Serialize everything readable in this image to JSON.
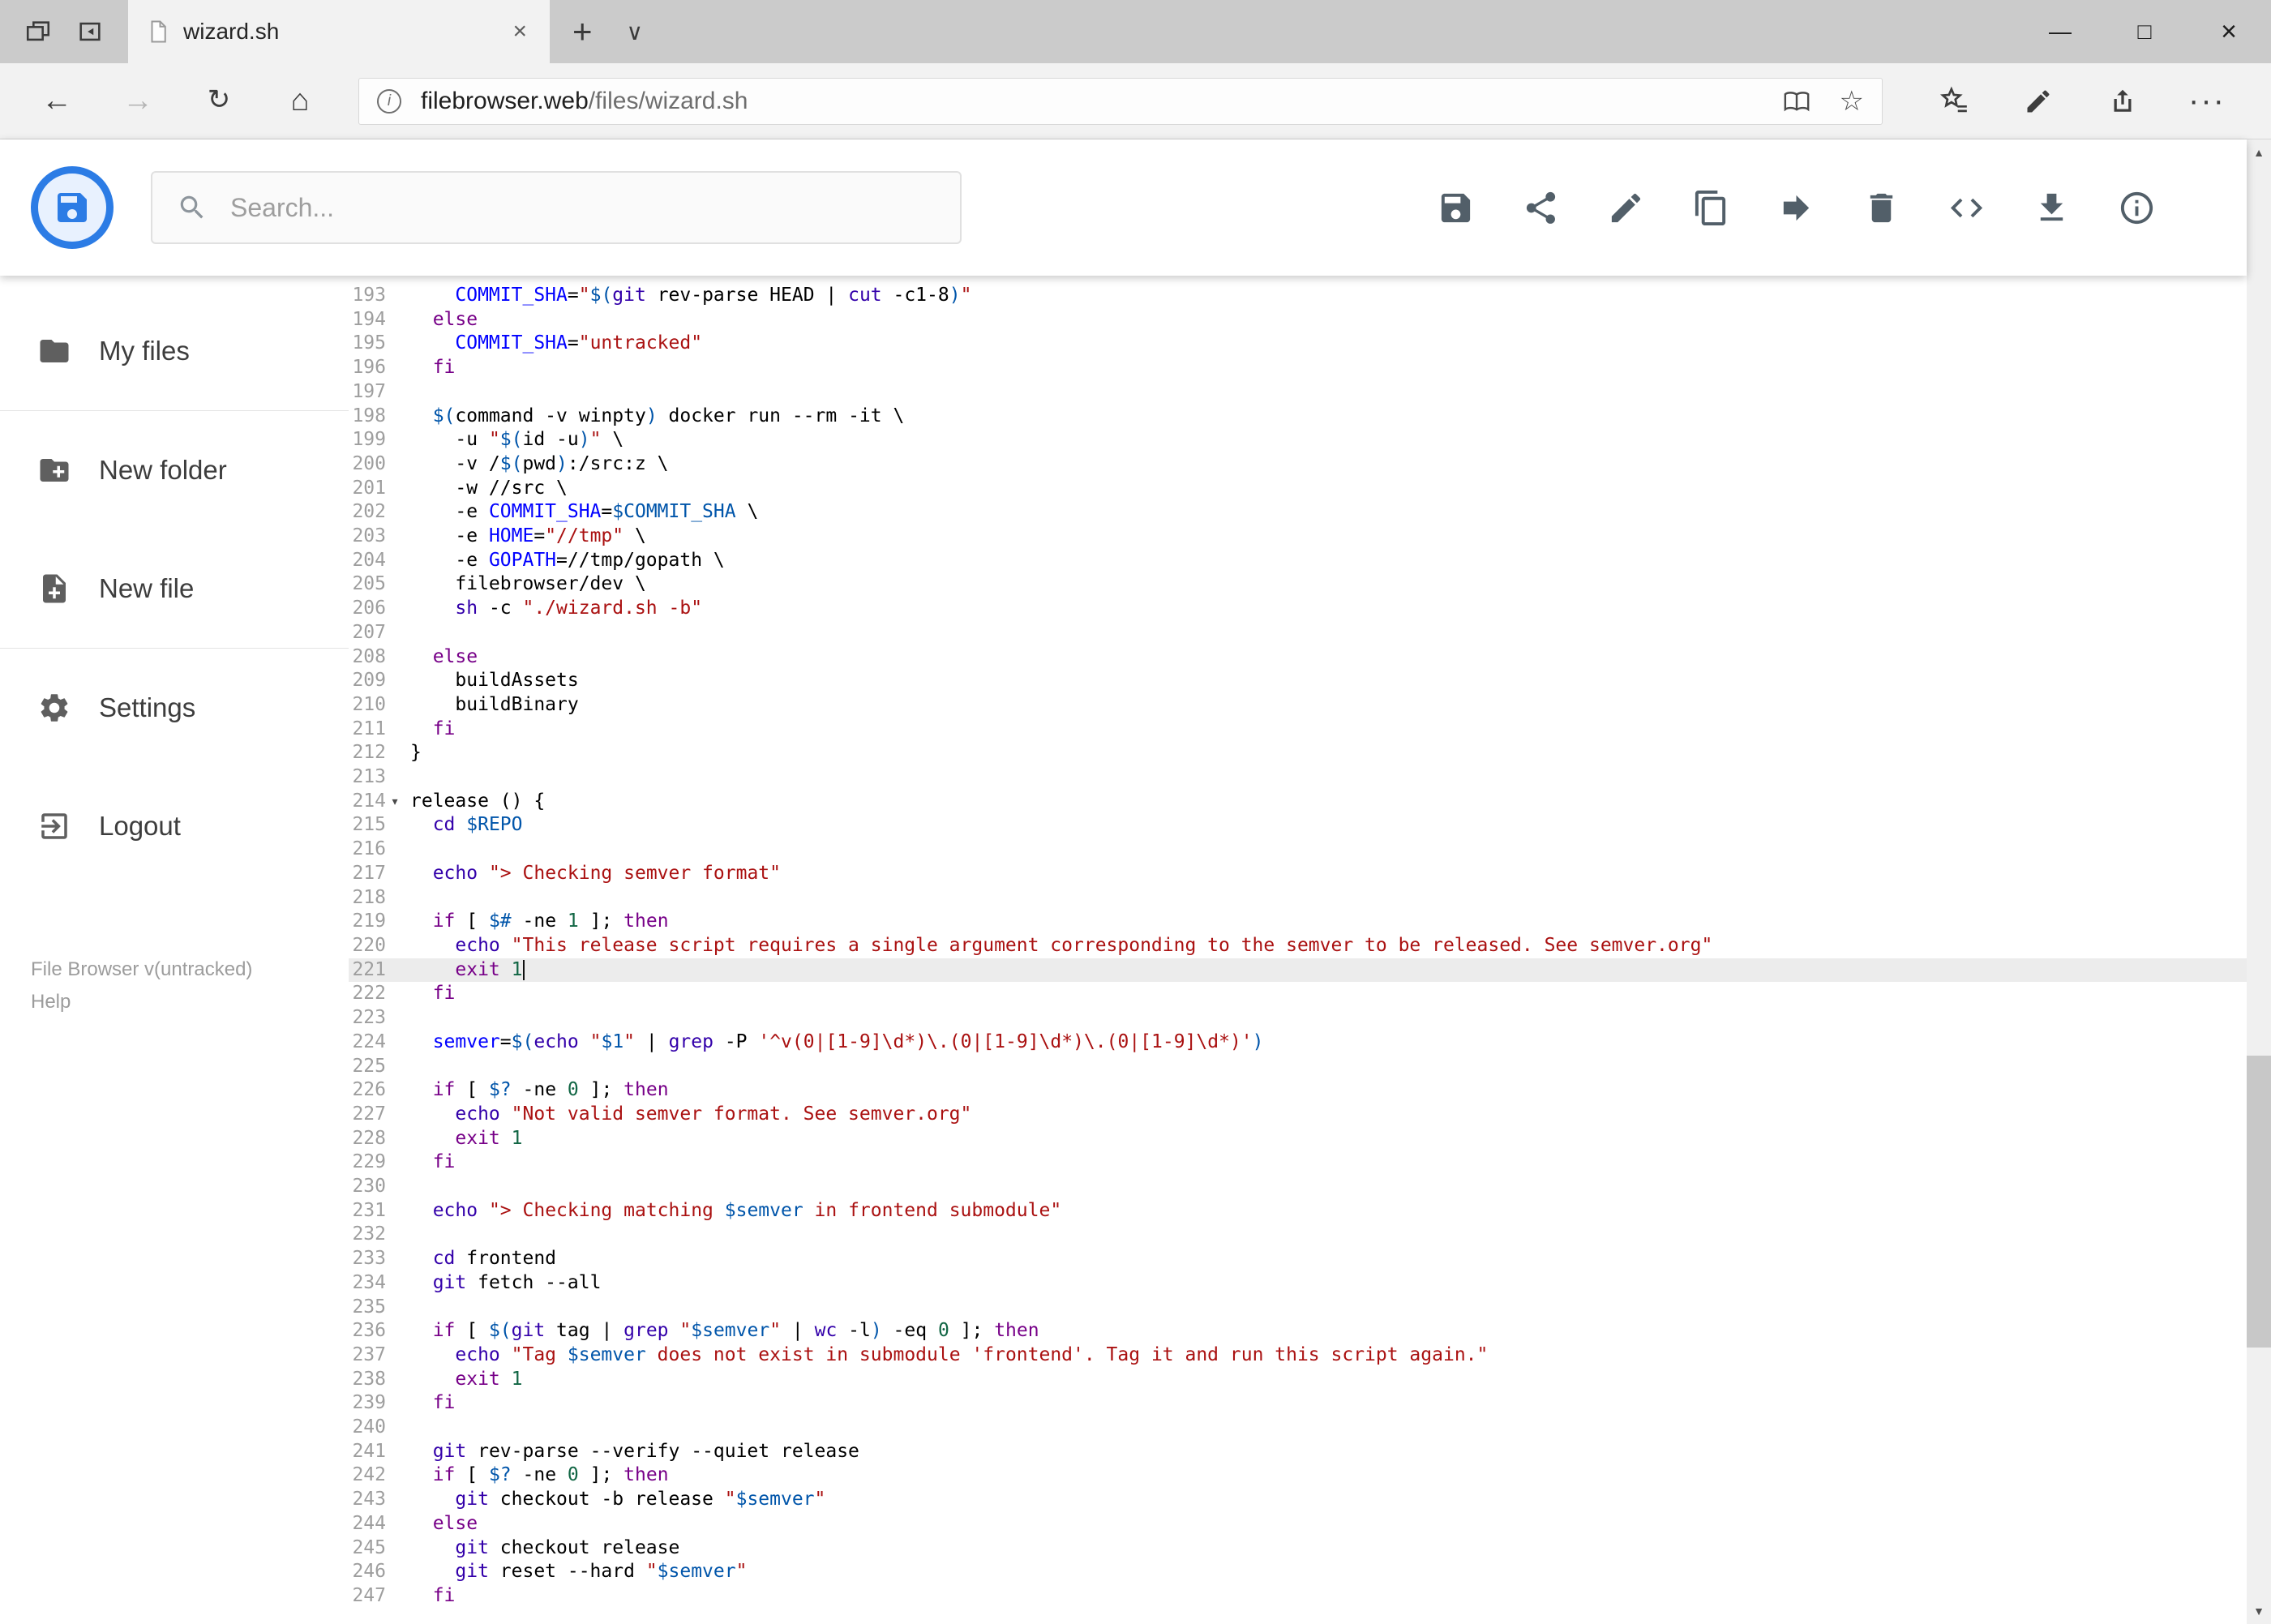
{
  "browser": {
    "tab_title": "wizard.sh",
    "url_host": "filebrowser.web",
    "url_path": "/files/wizard.sh"
  },
  "icons": {
    "back": "←",
    "forward": "→",
    "refresh": "↻",
    "home": "⌂",
    "new_tab": "+",
    "tab_preview": "∨",
    "minimize": "—",
    "maximize": "□",
    "close_window": "×",
    "close_tab": "×",
    "info_badge": "i",
    "favorite_star": "☆",
    "more": "···",
    "code_button_glyph": "<>",
    "scroll_up": "▲",
    "scroll_down": "▼",
    "fold_marker": "▾"
  },
  "header": {
    "search_placeholder": "Search...",
    "actions": [
      "save",
      "share",
      "rename",
      "copy",
      "move",
      "delete",
      "code",
      "download",
      "info"
    ]
  },
  "sidebar": {
    "items": [
      {
        "label": "My files"
      },
      {
        "label": "New folder"
      },
      {
        "label": "New file"
      },
      {
        "label": "Settings"
      },
      {
        "label": "Logout"
      }
    ],
    "footer_version": "File Browser v(untracked)",
    "footer_help": "Help"
  },
  "colors": {
    "accent_blue": "#2c7ce5",
    "keyword": "#770088",
    "builtin": "#3300aa",
    "string": "#aa1111",
    "variable": "#0055aa",
    "definition": "#0000ff",
    "number": "#116644",
    "active_line_bg": "#ececec"
  },
  "editor": {
    "active_line": 221,
    "cursor_line": 221,
    "lines": [
      {
        "n": 193,
        "t": [
          [
            "p",
            "    "
          ],
          [
            "d",
            "COMMIT_SHA"
          ],
          [
            "p",
            "="
          ],
          [
            "s",
            "\""
          ],
          [
            "v",
            "$("
          ],
          [
            "b",
            "git"
          ],
          [
            "p",
            " rev-parse HEAD | "
          ],
          [
            "b",
            "cut"
          ],
          [
            "p",
            " -c1-8"
          ],
          [
            "v",
            ")"
          ],
          [
            "s",
            "\""
          ]
        ]
      },
      {
        "n": 194,
        "t": [
          [
            "p",
            "  "
          ],
          [
            "k",
            "else"
          ]
        ]
      },
      {
        "n": 195,
        "t": [
          [
            "p",
            "    "
          ],
          [
            "d",
            "COMMIT_SHA"
          ],
          [
            "p",
            "="
          ],
          [
            "s",
            "\"untracked\""
          ]
        ]
      },
      {
        "n": 196,
        "t": [
          [
            "p",
            "  "
          ],
          [
            "k",
            "fi"
          ]
        ]
      },
      {
        "n": 197,
        "t": []
      },
      {
        "n": 198,
        "t": [
          [
            "p",
            "  "
          ],
          [
            "v",
            "$("
          ],
          [
            "p",
            "command -v winpty"
          ],
          [
            "v",
            ")"
          ],
          [
            "p",
            " docker run --rm -it \\"
          ]
        ]
      },
      {
        "n": 199,
        "t": [
          [
            "p",
            "    -u "
          ],
          [
            "s",
            "\""
          ],
          [
            "v",
            "$("
          ],
          [
            "p",
            "id -u"
          ],
          [
            "v",
            ")"
          ],
          [
            "s",
            "\""
          ],
          [
            "p",
            " \\"
          ]
        ]
      },
      {
        "n": 200,
        "t": [
          [
            "p",
            "    -v /"
          ],
          [
            "v",
            "$("
          ],
          [
            "p",
            "pwd"
          ],
          [
            "v",
            ")"
          ],
          [
            "p",
            ":/src:z \\"
          ]
        ]
      },
      {
        "n": 201,
        "t": [
          [
            "p",
            "    -w //src \\"
          ]
        ]
      },
      {
        "n": 202,
        "t": [
          [
            "p",
            "    -e "
          ],
          [
            "d",
            "COMMIT_SHA"
          ],
          [
            "p",
            "="
          ],
          [
            "v",
            "$COMMIT_SHA"
          ],
          [
            "p",
            " \\"
          ]
        ]
      },
      {
        "n": 203,
        "t": [
          [
            "p",
            "    -e "
          ],
          [
            "d",
            "HOME"
          ],
          [
            "p",
            "="
          ],
          [
            "s",
            "\"//tmp\""
          ],
          [
            "p",
            " \\"
          ]
        ]
      },
      {
        "n": 204,
        "t": [
          [
            "p",
            "    -e "
          ],
          [
            "d",
            "GOPATH"
          ],
          [
            "p",
            "=//tmp/gopath \\"
          ]
        ]
      },
      {
        "n": 205,
        "t": [
          [
            "p",
            "    filebrowser/dev \\"
          ]
        ]
      },
      {
        "n": 206,
        "t": [
          [
            "p",
            "    "
          ],
          [
            "b",
            "sh"
          ],
          [
            "p",
            " -c "
          ],
          [
            "s",
            "\"./wizard.sh -b\""
          ]
        ]
      },
      {
        "n": 207,
        "t": []
      },
      {
        "n": 208,
        "t": [
          [
            "p",
            "  "
          ],
          [
            "k",
            "else"
          ]
        ]
      },
      {
        "n": 209,
        "t": [
          [
            "p",
            "    buildAssets"
          ]
        ]
      },
      {
        "n": 210,
        "t": [
          [
            "p",
            "    buildBinary"
          ]
        ]
      },
      {
        "n": 211,
        "t": [
          [
            "p",
            "  "
          ],
          [
            "k",
            "fi"
          ]
        ]
      },
      {
        "n": 212,
        "t": [
          [
            "p",
            "}"
          ]
        ]
      },
      {
        "n": 213,
        "t": []
      },
      {
        "n": 214,
        "fold": true,
        "t": [
          [
            "p",
            "release () {"
          ]
        ]
      },
      {
        "n": 215,
        "t": [
          [
            "p",
            "  "
          ],
          [
            "b",
            "cd"
          ],
          [
            "p",
            " "
          ],
          [
            "v",
            "$REPO"
          ]
        ]
      },
      {
        "n": 216,
        "t": []
      },
      {
        "n": 217,
        "t": [
          [
            "p",
            "  "
          ],
          [
            "b",
            "echo"
          ],
          [
            "p",
            " "
          ],
          [
            "s",
            "\"> Checking semver format\""
          ]
        ]
      },
      {
        "n": 218,
        "t": []
      },
      {
        "n": 219,
        "t": [
          [
            "p",
            "  "
          ],
          [
            "k",
            "if"
          ],
          [
            "p",
            " [ "
          ],
          [
            "v",
            "$#"
          ],
          [
            "p",
            " -ne "
          ],
          [
            "num",
            "1"
          ],
          [
            "p",
            " ]; "
          ],
          [
            "k",
            "then"
          ]
        ]
      },
      {
        "n": 220,
        "t": [
          [
            "p",
            "    "
          ],
          [
            "b",
            "echo"
          ],
          [
            "p",
            " "
          ],
          [
            "s",
            "\"This release script requires a single argument corresponding to the semver to be released. See semver.org\""
          ]
        ]
      },
      {
        "n": 221,
        "t": [
          [
            "p",
            "    "
          ],
          [
            "k",
            "exit"
          ],
          [
            "p",
            " "
          ],
          [
            "num",
            "1"
          ]
        ]
      },
      {
        "n": 222,
        "t": [
          [
            "p",
            "  "
          ],
          [
            "k",
            "fi"
          ]
        ]
      },
      {
        "n": 223,
        "t": []
      },
      {
        "n": 224,
        "t": [
          [
            "p",
            "  "
          ],
          [
            "d",
            "semver"
          ],
          [
            "p",
            "="
          ],
          [
            "v",
            "$("
          ],
          [
            "b",
            "echo"
          ],
          [
            "p",
            " "
          ],
          [
            "s",
            "\""
          ],
          [
            "v",
            "$1"
          ],
          [
            "s",
            "\""
          ],
          [
            "p",
            " | "
          ],
          [
            "b",
            "grep"
          ],
          [
            "p",
            " -P "
          ],
          [
            "s",
            "'^v(0|[1-9]\\d*)\\.(0|[1-9]\\d*)\\.(0|[1-9]\\d*)'"
          ],
          [
            "v",
            ")"
          ]
        ]
      },
      {
        "n": 225,
        "t": []
      },
      {
        "n": 226,
        "t": [
          [
            "p",
            "  "
          ],
          [
            "k",
            "if"
          ],
          [
            "p",
            " [ "
          ],
          [
            "v",
            "$?"
          ],
          [
            "p",
            " -ne "
          ],
          [
            "num",
            "0"
          ],
          [
            "p",
            " ]; "
          ],
          [
            "k",
            "then"
          ]
        ]
      },
      {
        "n": 227,
        "t": [
          [
            "p",
            "    "
          ],
          [
            "b",
            "echo"
          ],
          [
            "p",
            " "
          ],
          [
            "s",
            "\"Not valid semver format. See semver.org\""
          ]
        ]
      },
      {
        "n": 228,
        "t": [
          [
            "p",
            "    "
          ],
          [
            "k",
            "exit"
          ],
          [
            "p",
            " "
          ],
          [
            "num",
            "1"
          ]
        ]
      },
      {
        "n": 229,
        "t": [
          [
            "p",
            "  "
          ],
          [
            "k",
            "fi"
          ]
        ]
      },
      {
        "n": 230,
        "t": []
      },
      {
        "n": 231,
        "t": [
          [
            "p",
            "  "
          ],
          [
            "b",
            "echo"
          ],
          [
            "p",
            " "
          ],
          [
            "s",
            "\"> Checking matching "
          ],
          [
            "v",
            "$semver"
          ],
          [
            "s",
            " in frontend submodule\""
          ]
        ]
      },
      {
        "n": 232,
        "t": []
      },
      {
        "n": 233,
        "t": [
          [
            "p",
            "  "
          ],
          [
            "b",
            "cd"
          ],
          [
            "p",
            " frontend"
          ]
        ]
      },
      {
        "n": 234,
        "t": [
          [
            "p",
            "  "
          ],
          [
            "b",
            "git"
          ],
          [
            "p",
            " fetch --all"
          ]
        ]
      },
      {
        "n": 235,
        "t": []
      },
      {
        "n": 236,
        "t": [
          [
            "p",
            "  "
          ],
          [
            "k",
            "if"
          ],
          [
            "p",
            " [ "
          ],
          [
            "v",
            "$("
          ],
          [
            "b",
            "git"
          ],
          [
            "p",
            " tag | "
          ],
          [
            "b",
            "grep"
          ],
          [
            "p",
            " "
          ],
          [
            "s",
            "\""
          ],
          [
            "v",
            "$semver"
          ],
          [
            "s",
            "\""
          ],
          [
            "p",
            " | "
          ],
          [
            "b",
            "wc"
          ],
          [
            "p",
            " -l"
          ],
          [
            "v",
            ")"
          ],
          [
            "p",
            " -eq "
          ],
          [
            "num",
            "0"
          ],
          [
            "p",
            " ]; "
          ],
          [
            "k",
            "then"
          ]
        ]
      },
      {
        "n": 237,
        "t": [
          [
            "p",
            "    "
          ],
          [
            "b",
            "echo"
          ],
          [
            "p",
            " "
          ],
          [
            "s",
            "\"Tag "
          ],
          [
            "v",
            "$semver"
          ],
          [
            "s",
            " does not exist in submodule 'frontend'. Tag it and run this script again.\""
          ]
        ]
      },
      {
        "n": 238,
        "t": [
          [
            "p",
            "    "
          ],
          [
            "k",
            "exit"
          ],
          [
            "p",
            " "
          ],
          [
            "num",
            "1"
          ]
        ]
      },
      {
        "n": 239,
        "t": [
          [
            "p",
            "  "
          ],
          [
            "k",
            "fi"
          ]
        ]
      },
      {
        "n": 240,
        "t": []
      },
      {
        "n": 241,
        "t": [
          [
            "p",
            "  "
          ],
          [
            "b",
            "git"
          ],
          [
            "p",
            " rev-parse --verify --quiet release"
          ]
        ]
      },
      {
        "n": 242,
        "t": [
          [
            "p",
            "  "
          ],
          [
            "k",
            "if"
          ],
          [
            "p",
            " [ "
          ],
          [
            "v",
            "$?"
          ],
          [
            "p",
            " -ne "
          ],
          [
            "num",
            "0"
          ],
          [
            "p",
            " ]; "
          ],
          [
            "k",
            "then"
          ]
        ]
      },
      {
        "n": 243,
        "t": [
          [
            "p",
            "    "
          ],
          [
            "b",
            "git"
          ],
          [
            "p",
            " checkout -b release "
          ],
          [
            "s",
            "\""
          ],
          [
            "v",
            "$semver"
          ],
          [
            "s",
            "\""
          ]
        ]
      },
      {
        "n": 244,
        "t": [
          [
            "p",
            "  "
          ],
          [
            "k",
            "else"
          ]
        ]
      },
      {
        "n": 245,
        "t": [
          [
            "p",
            "    "
          ],
          [
            "b",
            "git"
          ],
          [
            "p",
            " checkout release"
          ]
        ]
      },
      {
        "n": 246,
        "t": [
          [
            "p",
            "    "
          ],
          [
            "b",
            "git"
          ],
          [
            "p",
            " reset --hard "
          ],
          [
            "s",
            "\""
          ],
          [
            "v",
            "$semver"
          ],
          [
            "s",
            "\""
          ]
        ]
      },
      {
        "n": 247,
        "t": [
          [
            "p",
            "  "
          ],
          [
            "k",
            "fi"
          ]
        ]
      }
    ]
  }
}
